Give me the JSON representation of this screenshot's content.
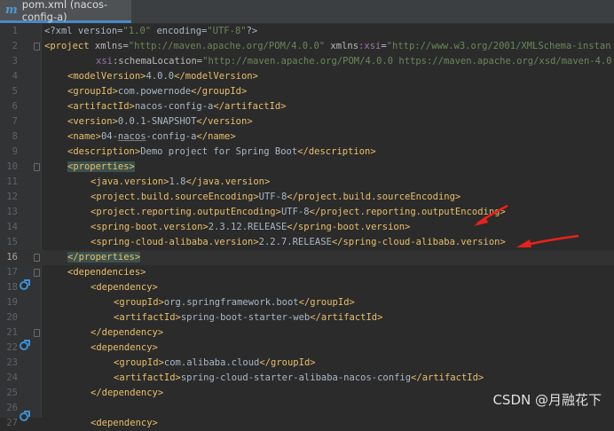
{
  "tab": {
    "title": "pom.xml (nacos-config-a)",
    "icon": "maven-icon"
  },
  "line_numbers": [
    "1",
    "2",
    "3",
    "4",
    "5",
    "6",
    "7",
    "8",
    "9",
    "10",
    "11",
    "12",
    "13",
    "14",
    "15",
    "16",
    "17",
    "18",
    "19",
    "20",
    "21",
    "22",
    "23",
    "24",
    "25",
    "26",
    "27"
  ],
  "code": {
    "l1": {
      "a": "<?xml version=",
      "b": "\"1.0\"",
      "c": " encoding=",
      "d": "\"UTF-8\"",
      "e": "?>"
    },
    "l2": {
      "a": "<project ",
      "b": "xmlns",
      "c": "=",
      "d": "\"http://maven.apache.org/POM/4.0.0\"",
      "e": " xmlns",
      "f": ":xsi",
      "g": "=",
      "h": "\"http://www.w3.org/2001/XMLSchema-instan"
    },
    "l3": {
      "a": "xsi",
      "b": ":schemaLocation",
      "c": "=",
      "d": "\"http://maven.apache.org/POM/4.0.0 https://maven.apache.org/xsd/maven-4.0"
    },
    "l4": {
      "o": "<modelVersion>",
      "v": "4.0.0",
      "c": "</modelVersion>"
    },
    "l5": {
      "o": "<groupId>",
      "v": "com.powernode",
      "c": "</groupId>"
    },
    "l6": {
      "o": "<artifactId>",
      "v": "nacos-config-a",
      "c": "</artifactId>"
    },
    "l7": {
      "o": "<version>",
      "v": "0.0.1-SNAPSHOT",
      "c": "</version>"
    },
    "l8": {
      "o": "<name>",
      "v1": "04-",
      "v2": "nacos",
      "v3": "-config-a",
      "c": "</name>"
    },
    "l9": {
      "o": "<description>",
      "v": "Demo project for Spring Boot",
      "c": "</description>"
    },
    "l10": {
      "o": "<properties>"
    },
    "l11": {
      "o": "<java.version>",
      "v": "1.8",
      "c": "</java.version>"
    },
    "l12": {
      "o": "<project.build.sourceEncoding>",
      "v": "UTF-8",
      "c": "</project.build.sourceEncoding>"
    },
    "l13": {
      "o": "<project.reporting.outputEncoding>",
      "v": "UTF-8",
      "c": "</project.reporting.outputEncoding>"
    },
    "l14": {
      "o": "<spring-boot.version>",
      "v": "2.3.12.RELEASE",
      "c": "</spring-boot.version>"
    },
    "l15": {
      "o": "<spring-cloud-alibaba.version>",
      "v": "2.2.7.RELEASE",
      "c": "</spring-cloud-alibaba.version>"
    },
    "l16": {
      "o": "</properties>"
    },
    "l17": {
      "o": "<dependencies>"
    },
    "l18": {
      "o": "<dependency>"
    },
    "l19": {
      "o": "<groupId>",
      "v": "org.springframework.boot",
      "c": "</groupId>"
    },
    "l20": {
      "o": "<artifactId>",
      "v": "spring-boot-starter-web",
      "c": "</artifactId>"
    },
    "l21": {
      "o": "</dependency>"
    },
    "l22": {
      "o": "<dependency>"
    },
    "l23": {
      "o": "<groupId>",
      "v": "com.alibaba.cloud",
      "c": "</groupId>"
    },
    "l24": {
      "o": "<artifactId>",
      "v": "spring-cloud-starter-alibaba-nacos-config",
      "c": "</artifactId>"
    },
    "l25": {
      "o": "</dependency>"
    },
    "l27": {
      "o": "<dependency>"
    }
  },
  "watermark": "CSDN @月融花下",
  "colors": {
    "tag": "#e8bf6a",
    "attr_value": "#6a8759",
    "namespace": "#9876aa",
    "text": "#a9b7c6",
    "arrow": "#e8211c"
  }
}
